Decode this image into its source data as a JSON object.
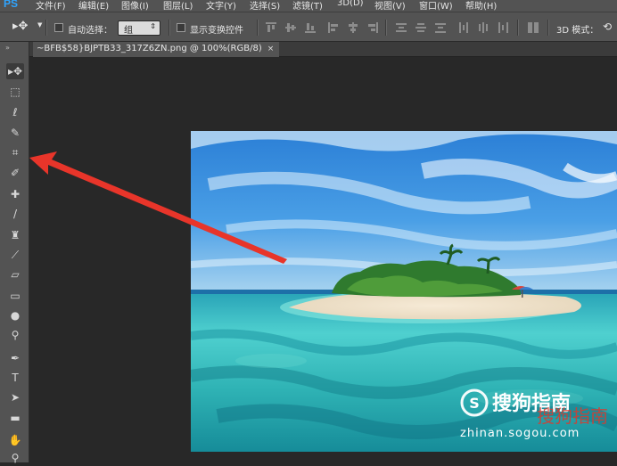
{
  "app": {
    "logo": "PS"
  },
  "menu": [
    "文件(F)",
    "编辑(E)",
    "图像(I)",
    "图层(L)",
    "文字(Y)",
    "选择(S)",
    "滤镜(T)",
    "3D(D)",
    "视图(V)",
    "窗口(W)",
    "帮助(H)"
  ],
  "options": {
    "auto_select_label": "自动选择：",
    "auto_select_value": "组",
    "show_transform_label": "显示变换控件",
    "mode_3d_label": "3D 模式："
  },
  "document": {
    "tab_title": "~BFB$58}BJPTB33_317Z6ZN.png @ 100%(RGB/8)",
    "close_glyph": "×"
  },
  "watermark": {
    "brand": "搜狗指南",
    "url": "zhinan.sogou.com",
    "overlay_text": "搜狗指南"
  },
  "colors": {
    "ui_dark": "#282828",
    "panel": "#535353",
    "arrow": "#e8352a",
    "ps_blue": "#2fa4ff"
  }
}
